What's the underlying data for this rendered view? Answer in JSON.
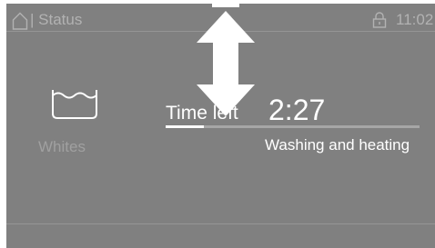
{
  "status_bar": {
    "home_icon": "home-icon",
    "title": "| Status",
    "lock_icon": "padlock-icon",
    "time": "11:02"
  },
  "program": {
    "icon": "wash-tub-icon",
    "label": "Whites"
  },
  "time_left": {
    "label": "Time left",
    "value": "2:27"
  },
  "progress": {
    "fraction": 0.15
  },
  "phase": "Washing and heating",
  "overlay": {
    "icon": "vertical-swipe-arrow-icon"
  },
  "colors": {
    "screen_background": "#808080",
    "primary_text": "#ffffff",
    "dim_text": "#b2b2b2"
  }
}
